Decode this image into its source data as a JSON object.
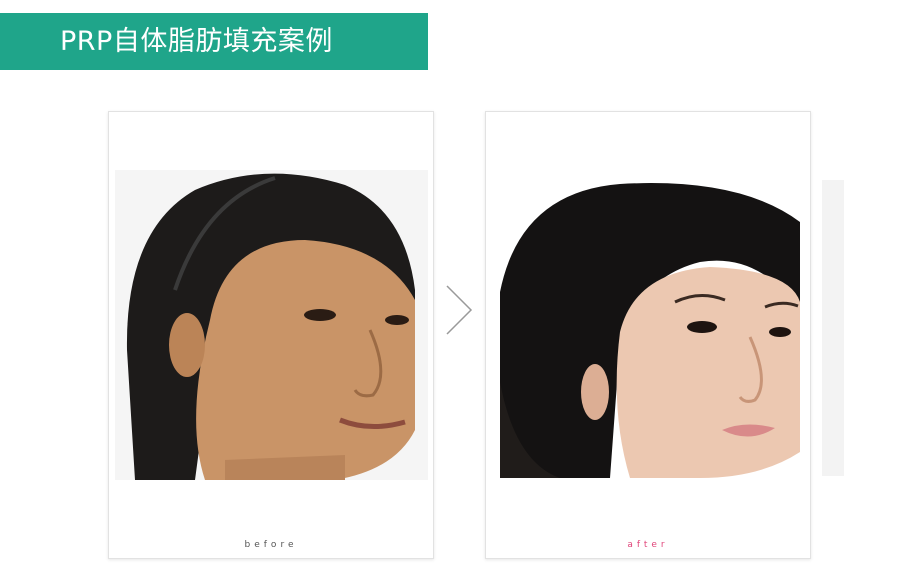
{
  "header": {
    "title": "PRP自体脂肪填充案例",
    "banner_color": "#1fa58a"
  },
  "comparison": {
    "before": {
      "label": "before",
      "label_color": "#555555",
      "image": "face-photo-before"
    },
    "after": {
      "label": "after",
      "label_color": "#e0457a",
      "image": "face-photo-after"
    },
    "divider_icon": "chevron-right-icon"
  }
}
